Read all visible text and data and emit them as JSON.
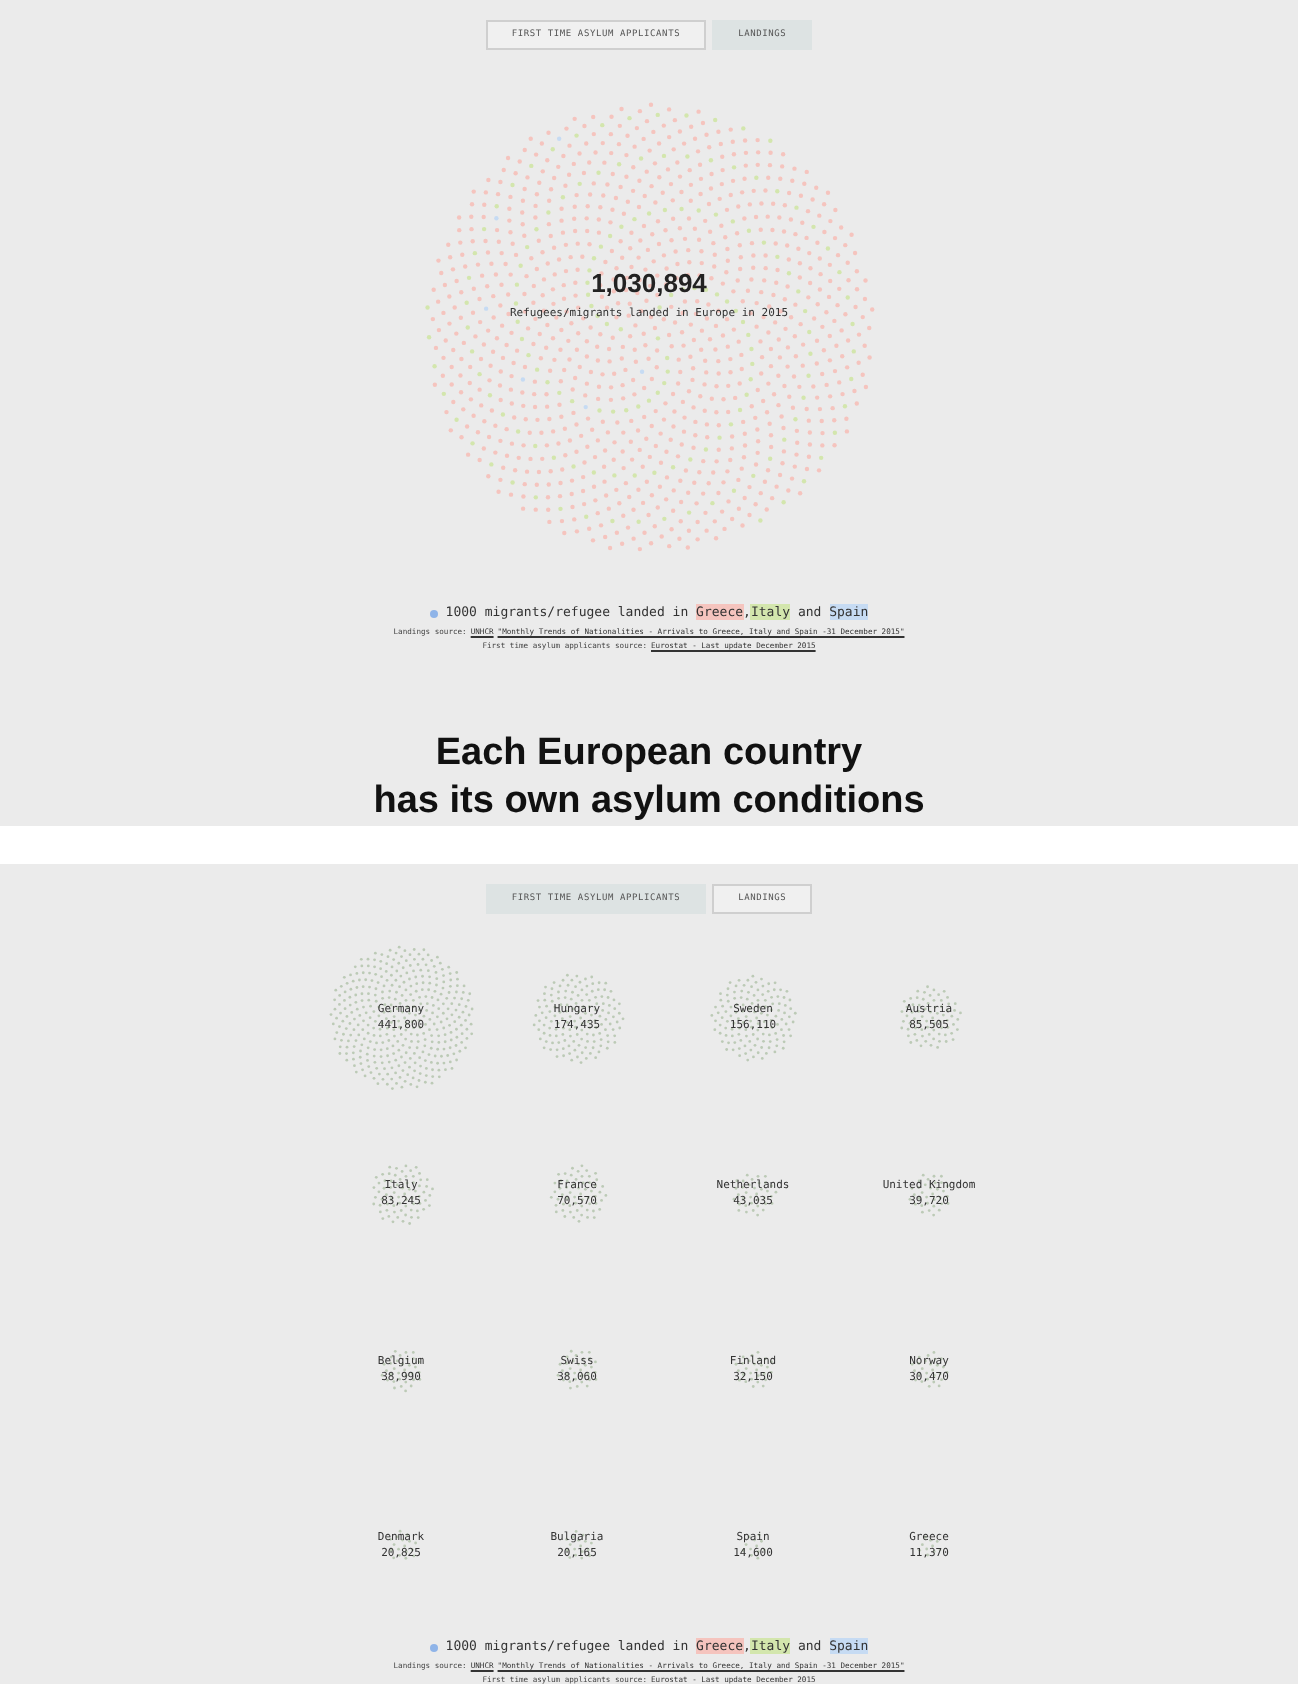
{
  "panels": [
    {
      "kind": "total",
      "tabs": [
        {
          "label": "FIRST TIME ASYLUM APPLICANTS",
          "selected": false
        },
        {
          "label": "LANDINGS",
          "selected": true
        }
      ],
      "total": {
        "value": "1,030,894",
        "caption": "Refugees/migrants landed in Europe in 2015"
      },
      "legend": {
        "text": "1000 migrants/refugee landed in",
        "countries": [
          {
            "name": "Greece",
            "color": "#f5c4be"
          },
          {
            "joiner": ",",
            "name": "Italy",
            "color": "#d3e6ad"
          },
          {
            "joiner": " and ",
            "name": "Spain",
            "color": "#c6dbf3"
          }
        ]
      },
      "sources": [
        [
          {
            "text": "Landings source: ",
            "link": false
          },
          {
            "text": "UNHCR",
            "link": true
          },
          {
            "text": "\"Monthly Trends of Nationalities - Arrivals to Greece, Italy and Spain -31 December 2015\"",
            "link": true
          }
        ],
        [
          {
            "text": "First time asylum applicants source:",
            "link": false
          },
          {
            "text": "Eurostat - Last update December 2015",
            "link": true
          }
        ]
      ],
      "headline": "Each European country\nhas its own asylum conditions"
    },
    {
      "kind": "countries",
      "tabs": [
        {
          "label": "FIRST TIME ASYLUM APPLICANTS",
          "selected": true
        },
        {
          "label": "LANDINGS",
          "selected": false
        }
      ],
      "countries": [
        {
          "name": "Germany",
          "value": "441,800"
        },
        {
          "name": "Hungary",
          "value": "174,435"
        },
        {
          "name": "Sweden",
          "value": "156,110"
        },
        {
          "name": "Austria",
          "value": "85,505"
        },
        {
          "name": "Italy",
          "value": "83,245"
        },
        {
          "name": "France",
          "value": "70,570"
        },
        {
          "name": "Netherlands",
          "value": "43,035"
        },
        {
          "name": "United Kingdom",
          "value": "39,720"
        },
        {
          "name": "Belgium",
          "value": "38,990"
        },
        {
          "name": "Swiss",
          "value": "38,060"
        },
        {
          "name": "Finland",
          "value": "32,150"
        },
        {
          "name": "Norway",
          "value": "30,470"
        },
        {
          "name": "Denmark",
          "value": "20,825"
        },
        {
          "name": "Bulgaria",
          "value": "20,165"
        },
        {
          "name": "Spain",
          "value": "14,600"
        },
        {
          "name": "Greece",
          "value": "11,370"
        }
      ],
      "legend": {
        "text": "1000 migrants/refugee landed in",
        "countries": [
          {
            "name": "Greece",
            "color": "#f5c4be"
          },
          {
            "joiner": ",",
            "name": "Italy",
            "color": "#d3e6ad"
          },
          {
            "joiner": " and ",
            "name": "Spain",
            "color": "#c6dbf3"
          }
        ]
      },
      "sources": [
        [
          {
            "text": "Landings source: ",
            "link": false
          },
          {
            "text": "UNHCR",
            "link": true
          },
          {
            "text": "\"Monthly Trends of Nationalities - Arrivals to Greece, Italy and Spain -31 December 2015\"",
            "link": true
          }
        ],
        [
          {
            "text": "First time asylum applicants source:",
            "link": false
          },
          {
            "text": "Eurostat - Last update December 2015",
            "link": true
          }
        ]
      ]
    }
  ]
}
